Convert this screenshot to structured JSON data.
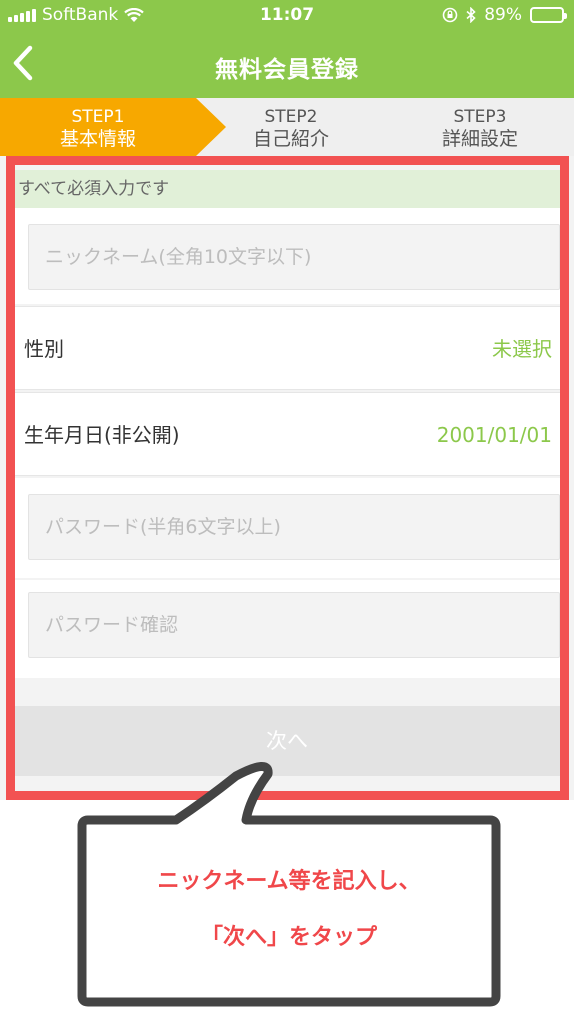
{
  "status_bar": {
    "carrier": "SoftBank",
    "time": "11:07",
    "battery": "89%",
    "battery_level": 0.89
  },
  "nav": {
    "title": "無料会員登録",
    "back_icon": "chevron-left-icon"
  },
  "steps": [
    {
      "label": "STEP1",
      "name": "基本情報",
      "active": true
    },
    {
      "label": "STEP2",
      "name": "自己紹介",
      "active": false
    },
    {
      "label": "STEP3",
      "name": "詳細設定",
      "active": false
    }
  ],
  "form": {
    "notice": "すべて必須入力です",
    "nickname_placeholder": "ニックネーム(全角10文字以下)",
    "gender_label": "性別",
    "gender_value": "未選択",
    "birthday_label": "生年月日(非公開)",
    "birthday_value": "2001/01/01",
    "password_placeholder": "パスワード(半角6文字以上)",
    "password_confirm_placeholder": "パスワード確認",
    "next_label": "次へ"
  },
  "callout": {
    "line1": "ニックネーム等を記入し、",
    "line2": "「次へ」をタップ"
  },
  "colors": {
    "brand_green": "#8cc84b",
    "step_active": "#f7a800",
    "highlight_red": "#f25252"
  }
}
